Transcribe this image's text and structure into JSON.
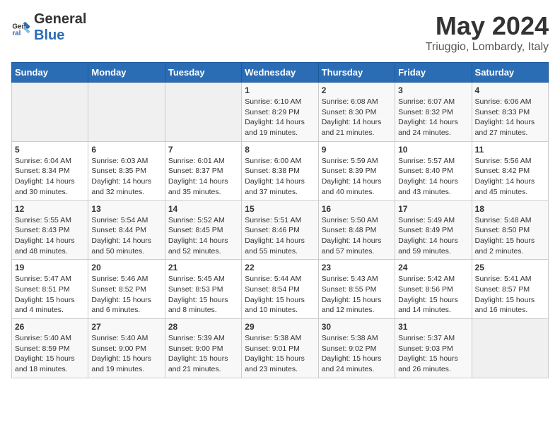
{
  "logo": {
    "text_general": "General",
    "text_blue": "Blue"
  },
  "header": {
    "month_title": "May 2024",
    "location": "Triuggio, Lombardy, Italy"
  },
  "days_of_week": [
    "Sunday",
    "Monday",
    "Tuesday",
    "Wednesday",
    "Thursday",
    "Friday",
    "Saturday"
  ],
  "weeks": [
    [
      {
        "day": "",
        "info": ""
      },
      {
        "day": "",
        "info": ""
      },
      {
        "day": "",
        "info": ""
      },
      {
        "day": "1",
        "info": "Sunrise: 6:10 AM\nSunset: 8:29 PM\nDaylight: 14 hours\nand 19 minutes."
      },
      {
        "day": "2",
        "info": "Sunrise: 6:08 AM\nSunset: 8:30 PM\nDaylight: 14 hours\nand 21 minutes."
      },
      {
        "day": "3",
        "info": "Sunrise: 6:07 AM\nSunset: 8:32 PM\nDaylight: 14 hours\nand 24 minutes."
      },
      {
        "day": "4",
        "info": "Sunrise: 6:06 AM\nSunset: 8:33 PM\nDaylight: 14 hours\nand 27 minutes."
      }
    ],
    [
      {
        "day": "5",
        "info": "Sunrise: 6:04 AM\nSunset: 8:34 PM\nDaylight: 14 hours\nand 30 minutes."
      },
      {
        "day": "6",
        "info": "Sunrise: 6:03 AM\nSunset: 8:35 PM\nDaylight: 14 hours\nand 32 minutes."
      },
      {
        "day": "7",
        "info": "Sunrise: 6:01 AM\nSunset: 8:37 PM\nDaylight: 14 hours\nand 35 minutes."
      },
      {
        "day": "8",
        "info": "Sunrise: 6:00 AM\nSunset: 8:38 PM\nDaylight: 14 hours\nand 37 minutes."
      },
      {
        "day": "9",
        "info": "Sunrise: 5:59 AM\nSunset: 8:39 PM\nDaylight: 14 hours\nand 40 minutes."
      },
      {
        "day": "10",
        "info": "Sunrise: 5:57 AM\nSunset: 8:40 PM\nDaylight: 14 hours\nand 43 minutes."
      },
      {
        "day": "11",
        "info": "Sunrise: 5:56 AM\nSunset: 8:42 PM\nDaylight: 14 hours\nand 45 minutes."
      }
    ],
    [
      {
        "day": "12",
        "info": "Sunrise: 5:55 AM\nSunset: 8:43 PM\nDaylight: 14 hours\nand 48 minutes."
      },
      {
        "day": "13",
        "info": "Sunrise: 5:54 AM\nSunset: 8:44 PM\nDaylight: 14 hours\nand 50 minutes."
      },
      {
        "day": "14",
        "info": "Sunrise: 5:52 AM\nSunset: 8:45 PM\nDaylight: 14 hours\nand 52 minutes."
      },
      {
        "day": "15",
        "info": "Sunrise: 5:51 AM\nSunset: 8:46 PM\nDaylight: 14 hours\nand 55 minutes."
      },
      {
        "day": "16",
        "info": "Sunrise: 5:50 AM\nSunset: 8:48 PM\nDaylight: 14 hours\nand 57 minutes."
      },
      {
        "day": "17",
        "info": "Sunrise: 5:49 AM\nSunset: 8:49 PM\nDaylight: 14 hours\nand 59 minutes."
      },
      {
        "day": "18",
        "info": "Sunrise: 5:48 AM\nSunset: 8:50 PM\nDaylight: 15 hours\nand 2 minutes."
      }
    ],
    [
      {
        "day": "19",
        "info": "Sunrise: 5:47 AM\nSunset: 8:51 PM\nDaylight: 15 hours\nand 4 minutes."
      },
      {
        "day": "20",
        "info": "Sunrise: 5:46 AM\nSunset: 8:52 PM\nDaylight: 15 hours\nand 6 minutes."
      },
      {
        "day": "21",
        "info": "Sunrise: 5:45 AM\nSunset: 8:53 PM\nDaylight: 15 hours\nand 8 minutes."
      },
      {
        "day": "22",
        "info": "Sunrise: 5:44 AM\nSunset: 8:54 PM\nDaylight: 15 hours\nand 10 minutes."
      },
      {
        "day": "23",
        "info": "Sunrise: 5:43 AM\nSunset: 8:55 PM\nDaylight: 15 hours\nand 12 minutes."
      },
      {
        "day": "24",
        "info": "Sunrise: 5:42 AM\nSunset: 8:56 PM\nDaylight: 15 hours\nand 14 minutes."
      },
      {
        "day": "25",
        "info": "Sunrise: 5:41 AM\nSunset: 8:57 PM\nDaylight: 15 hours\nand 16 minutes."
      }
    ],
    [
      {
        "day": "26",
        "info": "Sunrise: 5:40 AM\nSunset: 8:59 PM\nDaylight: 15 hours\nand 18 minutes."
      },
      {
        "day": "27",
        "info": "Sunrise: 5:40 AM\nSunset: 9:00 PM\nDaylight: 15 hours\nand 19 minutes."
      },
      {
        "day": "28",
        "info": "Sunrise: 5:39 AM\nSunset: 9:00 PM\nDaylight: 15 hours\nand 21 minutes."
      },
      {
        "day": "29",
        "info": "Sunrise: 5:38 AM\nSunset: 9:01 PM\nDaylight: 15 hours\nand 23 minutes."
      },
      {
        "day": "30",
        "info": "Sunrise: 5:38 AM\nSunset: 9:02 PM\nDaylight: 15 hours\nand 24 minutes."
      },
      {
        "day": "31",
        "info": "Sunrise: 5:37 AM\nSunset: 9:03 PM\nDaylight: 15 hours\nand 26 minutes."
      },
      {
        "day": "",
        "info": ""
      }
    ]
  ]
}
